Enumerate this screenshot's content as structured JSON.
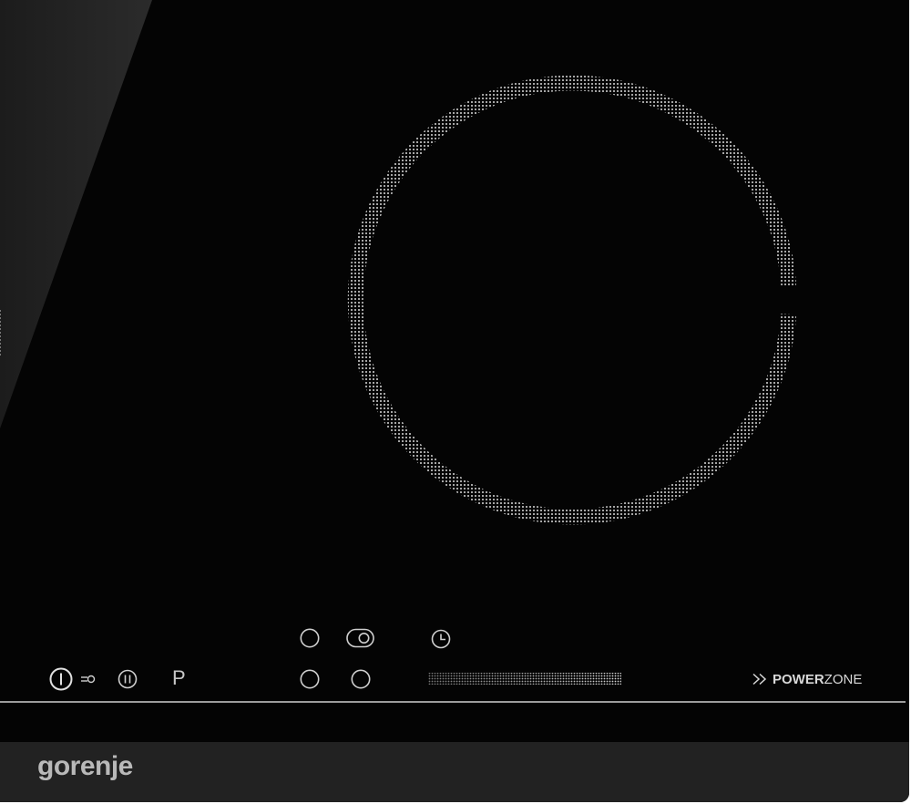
{
  "brand": {
    "name": "gorenje"
  },
  "controls": {
    "program_label": "P",
    "power_button": {
      "icon": "power-icon"
    },
    "lock_button": {
      "icon": "key-lock-icon"
    },
    "pause_button": {
      "icon": "pause-icon"
    },
    "timer_button": {
      "icon": "clock-icon"
    },
    "slider": {
      "icon": "touch-slider"
    }
  },
  "powerzone": {
    "bold": "POWER",
    "light": "ZONE"
  },
  "colors": {
    "glass": "#040404",
    "print": "#cfcfcf",
    "footer": "#222222",
    "brand": "#b9b9b9"
  }
}
